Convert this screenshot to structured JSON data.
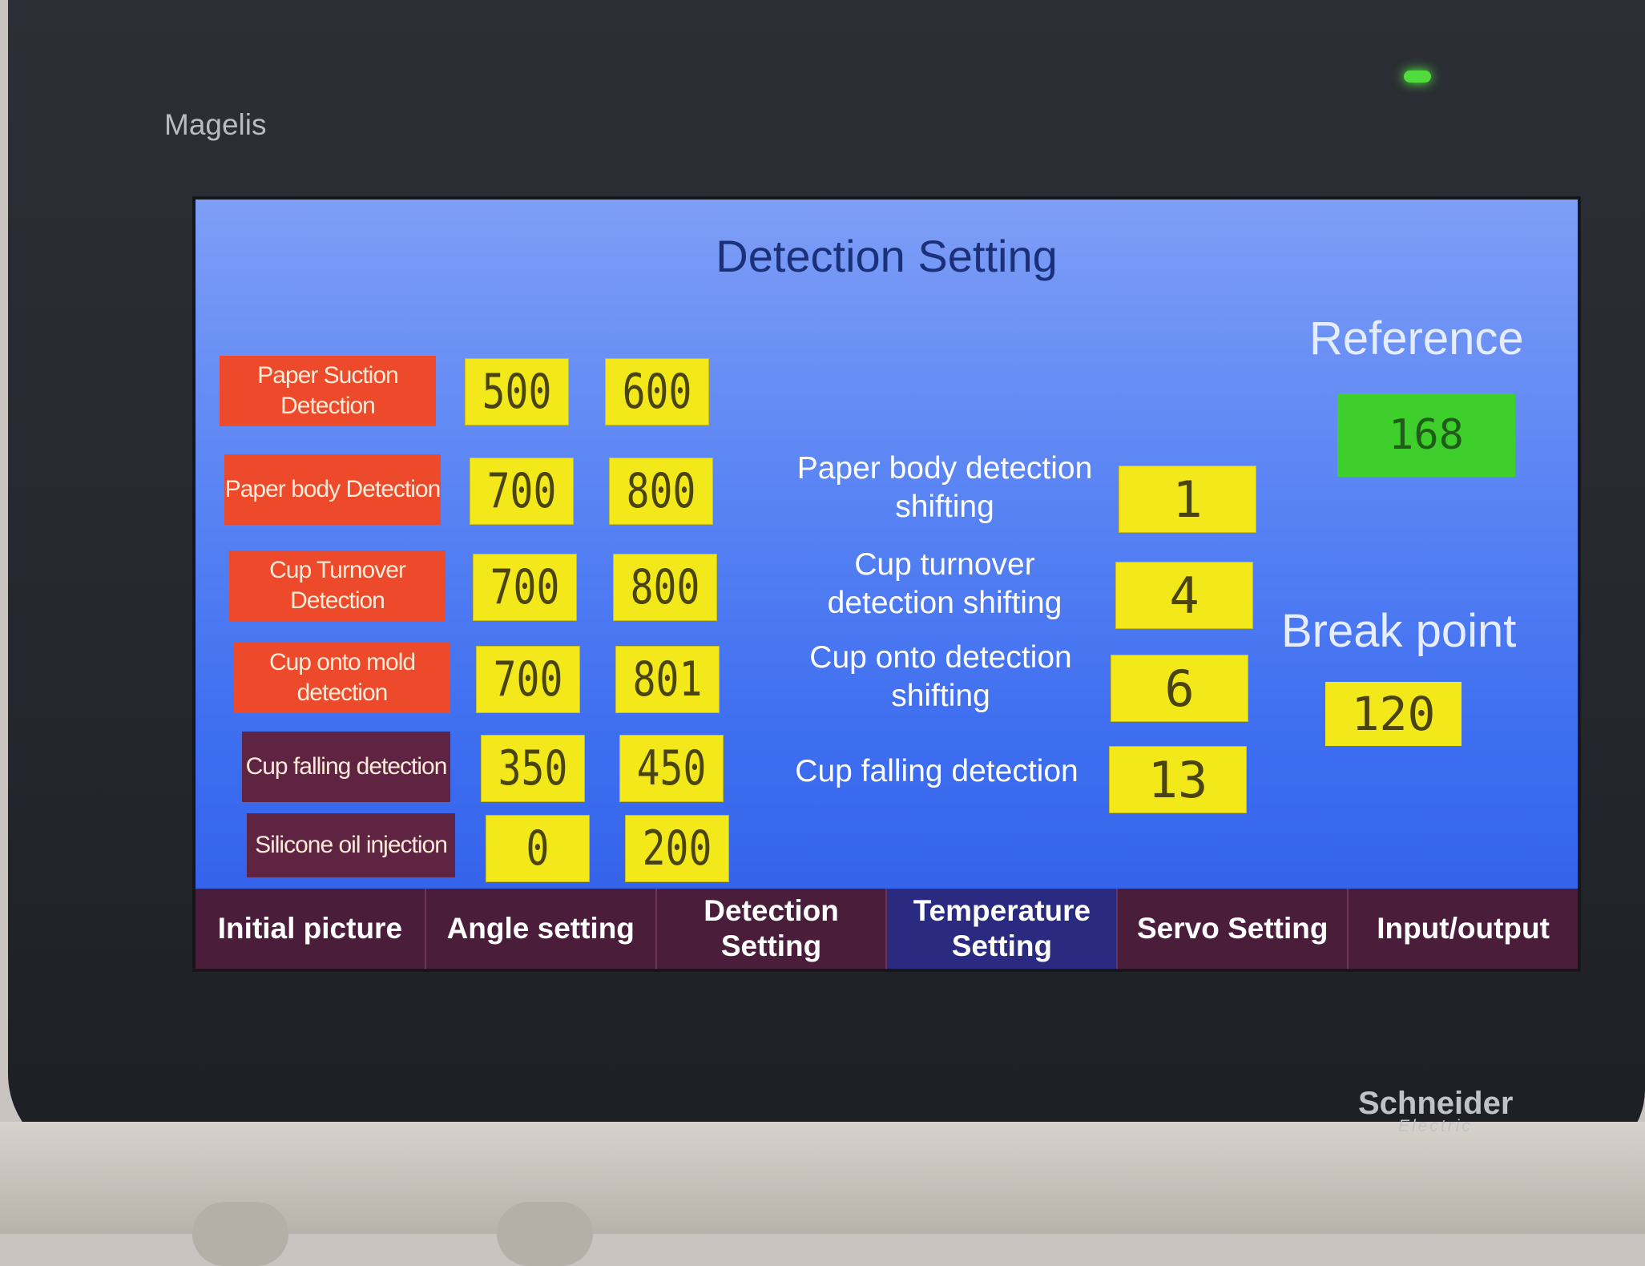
{
  "device": {
    "brand": "Magelis",
    "manufacturer": "Schneider",
    "manufacturer_sub": "Electric",
    "led_color": "#4fdc3c"
  },
  "screen": {
    "title": "Detection Setting",
    "rows": [
      {
        "label": "Paper Suction Detection",
        "min": "500",
        "max": "600",
        "color": "#ec4a2a"
      },
      {
        "label": "Paper body Detection",
        "min": "700",
        "max": "800",
        "color": "#ec4a2a"
      },
      {
        "label": "Cup Turnover Detection",
        "min": "700",
        "max": "800",
        "color": "#ec4a2a"
      },
      {
        "label": "Cup onto mold detection",
        "min": "700",
        "max": "801",
        "color": "#ec4a2a"
      },
      {
        "label": "Cup falling detection",
        "min": "350",
        "max": "450",
        "color": "#5e2442"
      },
      {
        "label": "Silicone oil injection",
        "min": "0",
        "max": "200",
        "color": "#5e2442"
      }
    ],
    "shifting": [
      {
        "label": "Paper body detection shifting",
        "value": "1"
      },
      {
        "label": "Cup turnover detection shifting",
        "value": "4"
      },
      {
        "label": "Cup onto detection shifting",
        "value": "6"
      },
      {
        "label": "Cup falling detection",
        "value": "13"
      }
    ],
    "reference": {
      "label": "Reference",
      "value": "168"
    },
    "break_point": {
      "label": "Break point",
      "value": "120"
    },
    "nav": [
      {
        "label": "Initial picture",
        "active": false
      },
      {
        "label": "Angle setting",
        "active": false
      },
      {
        "label": "Detection Setting",
        "active": true
      },
      {
        "label": "Temperature Setting",
        "active": false
      },
      {
        "label": "Servo Setting",
        "active": false
      },
      {
        "label": "Input/output",
        "active": false
      }
    ]
  }
}
